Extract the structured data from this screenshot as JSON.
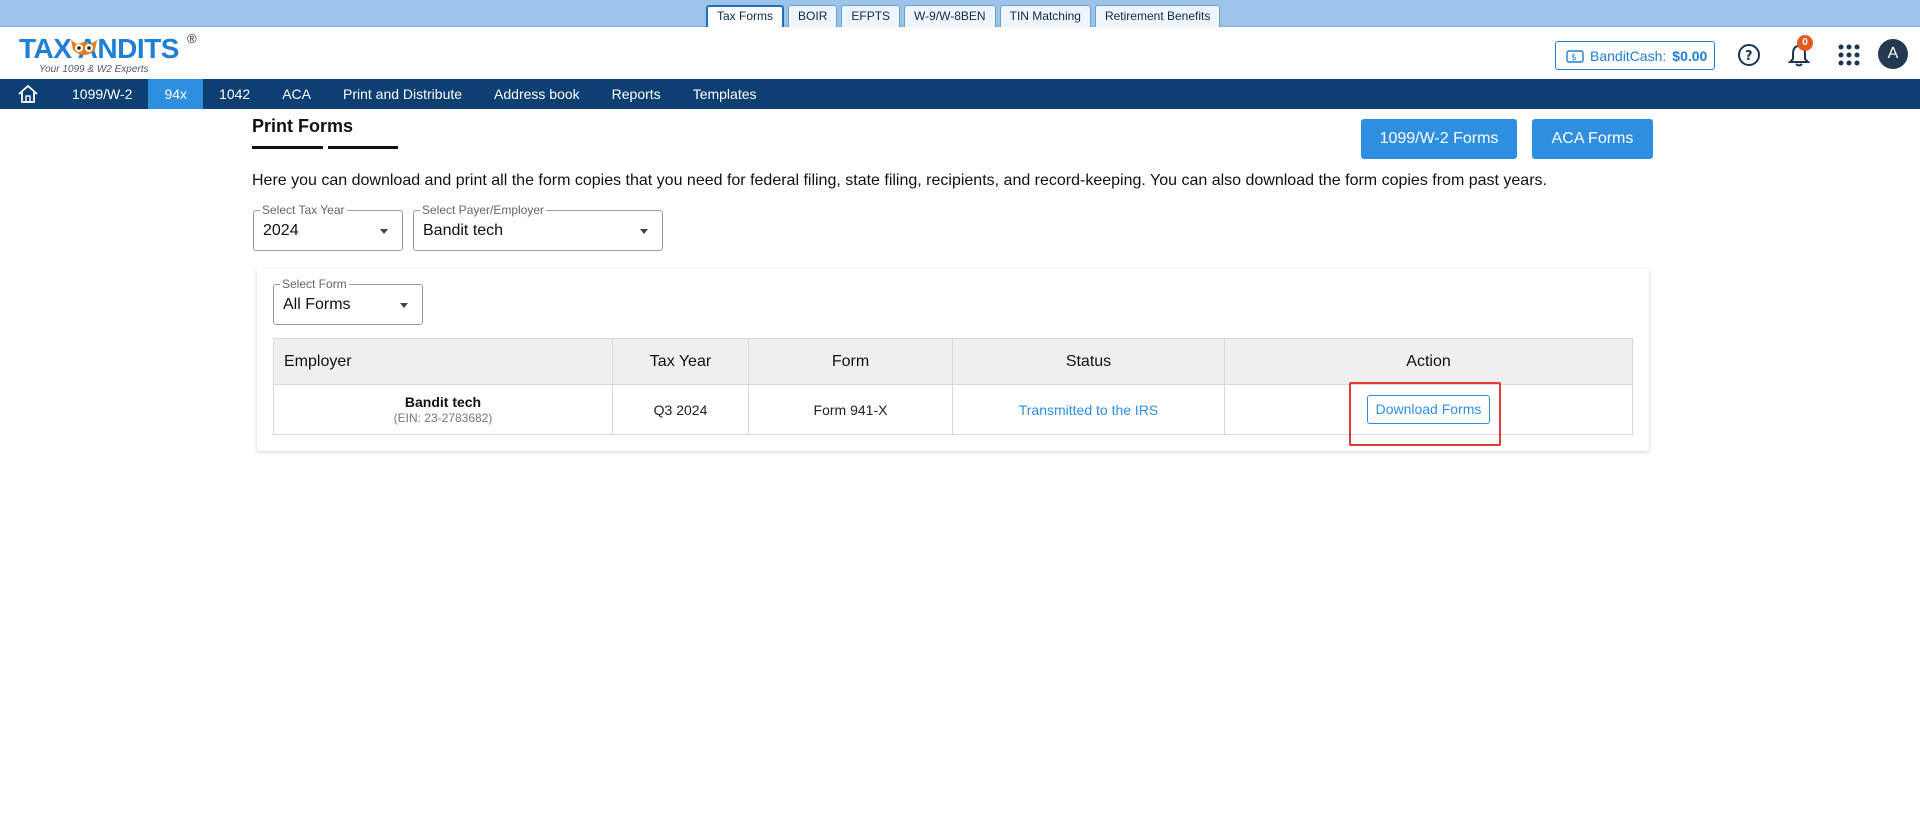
{
  "topstrip": {
    "tabs": [
      {
        "label": "Tax Forms",
        "active": true
      },
      {
        "label": "BOIR"
      },
      {
        "label": "EFPTS"
      },
      {
        "label": "W-9/W-8BEN"
      },
      {
        "label": "TIN Matching"
      },
      {
        "label": "Retirement Benefits"
      }
    ]
  },
  "header": {
    "logo_text": "TAX ANDITS",
    "logo_tagline": "Your 1099 & W2 Experts",
    "logo_reg": "®",
    "bandit_cash_label": "BanditCash:",
    "bandit_cash_value": "$0.00",
    "notification_count": "0",
    "avatar_initial": "A",
    "icons": [
      "bandit-cash-icon",
      "help-icon",
      "bell-icon",
      "apps-grid-icon"
    ]
  },
  "mainnav": {
    "home_icon": "home-icon",
    "items": [
      {
        "label": "1099/W-2"
      },
      {
        "label": "94x",
        "active": true
      },
      {
        "label": "1042"
      },
      {
        "label": "ACA"
      },
      {
        "label": "Print and Distribute"
      },
      {
        "label": "Address book"
      },
      {
        "label": "Reports"
      },
      {
        "label": "Templates"
      }
    ]
  },
  "page": {
    "title": "Print Forms",
    "btn_1099": "1099/W-2 Forms",
    "btn_aca": "ACA Forms",
    "description": "Here you can download and print all the form copies that you need for federal filing, state filing, recipients, and record-keeping. You can also download the form copies from past years."
  },
  "filters": {
    "tax_year": {
      "label": "Select Tax Year",
      "value": "2024"
    },
    "payer": {
      "label": "Select Payer/Employer",
      "value": "Bandit tech"
    },
    "form": {
      "label": "Select Form",
      "value": "All Forms"
    }
  },
  "table": {
    "headers": [
      "Employer",
      "Tax Year",
      "Form",
      "Status",
      "Action"
    ],
    "rows": [
      {
        "employer": "Bandit tech",
        "ein": "(EIN: 23-2783682)",
        "tax_year": "Q3 2024",
        "form": "Form 941-X",
        "status": "Transmitted to the IRS",
        "action": "Download Forms"
      }
    ]
  },
  "colors": {
    "nav_bg": "#0d3f73",
    "accent": "#2e8fe0",
    "highlight": "#e03a3a"
  }
}
